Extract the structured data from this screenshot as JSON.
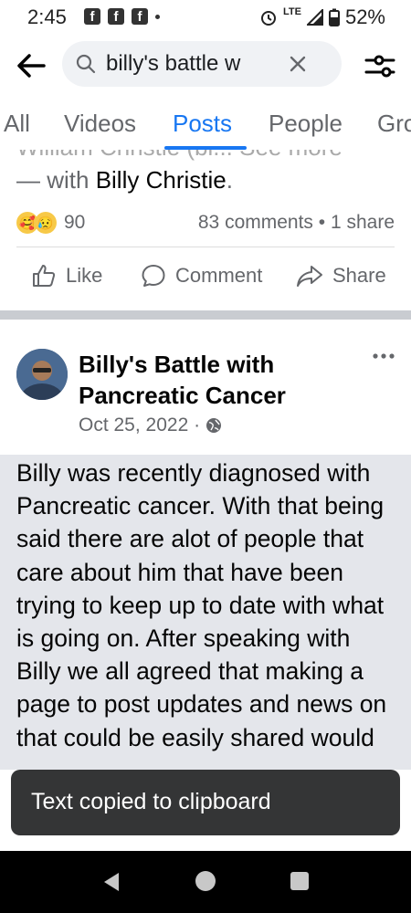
{
  "status_bar": {
    "time": "2:45",
    "network": "LTE",
    "battery": "52%"
  },
  "search": {
    "query": "billy's battle w"
  },
  "tabs": [
    {
      "label": "All"
    },
    {
      "label": "Videos"
    },
    {
      "label": "Posts"
    },
    {
      "label": "People"
    },
    {
      "label": "Gro"
    }
  ],
  "previous_post": {
    "cut_text": "William Christie (bi... See more",
    "with_prefix": "— with ",
    "with_name": "Billy Christie",
    "with_suffix": ".",
    "reaction_count": "90",
    "comments_shares": "83 comments • 1 share",
    "actions": {
      "like": "Like",
      "comment": "Comment",
      "share": "Share"
    }
  },
  "post": {
    "page_name": "Billy's Battle with Pancreatic Cancer",
    "date": "Oct 25, 2022 ·",
    "text": "Billy was recently diagnosed with Pancreatic cancer.  With that being said there are alot of people that care about him that have been trying to keep up to date with what is going on. After speaking with Billy we all agreed that making a page to post updates and news on that could be easily shared would"
  },
  "toast": {
    "message": "Text copied to clipboard"
  },
  "colors": {
    "accent": "#1877f2",
    "selection": "#e4e6eb",
    "toast_bg": "#343536"
  }
}
